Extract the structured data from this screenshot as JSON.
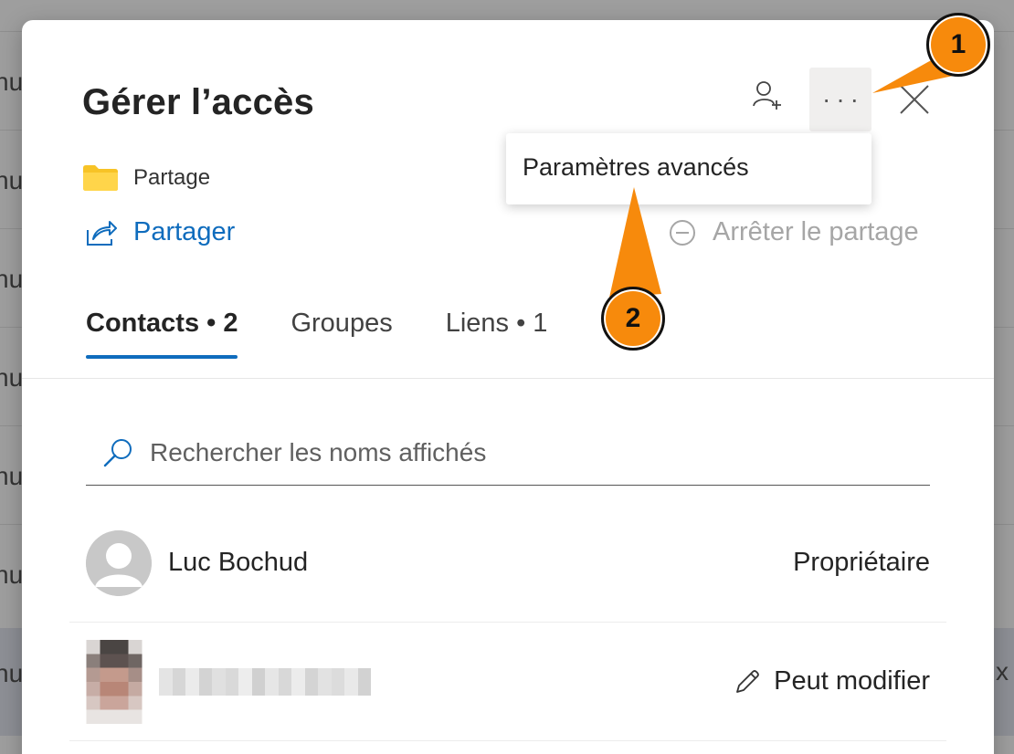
{
  "background": {
    "edge_text": "nu",
    "edge_text_right": "x p"
  },
  "dialog": {
    "title": "Gérer l’accès",
    "more_button_label": "···",
    "folder_name": "Partage",
    "share_label": "Partager",
    "stop_share_label": "Arrêter le partage",
    "menu": {
      "items": [
        "Paramètres avancés"
      ]
    },
    "tabs": [
      {
        "label": "Contacts • 2",
        "active": true
      },
      {
        "label": "Groupes",
        "active": false
      },
      {
        "label": "Liens • 1",
        "active": false
      }
    ],
    "search": {
      "placeholder": "Rechercher les noms affichés"
    },
    "people": [
      {
        "name": "Luc Bochud",
        "role": "Propriétaire",
        "avatar": "generic-person-icon"
      },
      {
        "name": "",
        "role": "Peut modifier",
        "avatar": "pixelated-photo",
        "role_icon": "pencil-icon"
      }
    ]
  },
  "callouts": [
    {
      "label": "1",
      "target": "more-options-button"
    },
    {
      "label": "2",
      "target": "advanced-settings-menu-item"
    }
  ],
  "colors": {
    "accent": "#0f6cbd",
    "callout": "#f78a0c",
    "disabled_text": "#a6a6a6"
  }
}
